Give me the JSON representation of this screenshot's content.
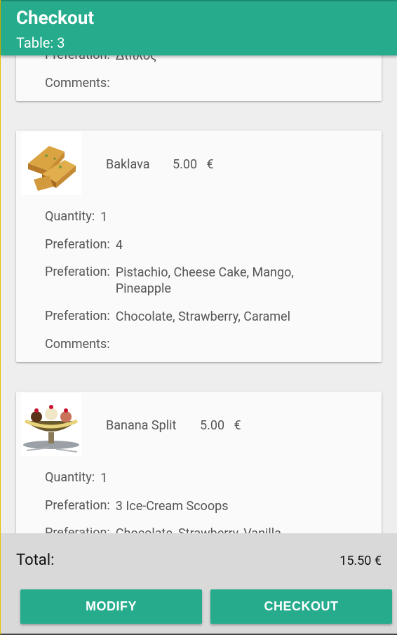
{
  "header": {
    "title": "Checkout",
    "subtitle": "Table: 3"
  },
  "labels": {
    "quantity": "Quantity:",
    "preference": "Preferation:",
    "comments": "Comments:"
  },
  "top_card": {
    "preference_value": "Διπλός"
  },
  "items": [
    {
      "name": "Baklava",
      "price": "5.00",
      "currency": "€",
      "image_icon": "baklava-image",
      "quantity": "1",
      "preferences": [
        "4",
        "Pistachio, Cheese Cake, Mango, Pineapple",
        "Chocolate, Strawberry, Caramel"
      ],
      "comments": ""
    },
    {
      "name": "Banana Split",
      "price": "5.00",
      "currency": "€",
      "image_icon": "banana-split-image",
      "quantity": "1",
      "preferences": [
        "3 Ice-Cream Scoops",
        "Chocolate, Strawberry, Vanilla"
      ]
    }
  ],
  "footer": {
    "total_label": "Total:",
    "total_value": "15.50 €",
    "modify_label": "MODIFY",
    "checkout_label": "CHECKOUT"
  },
  "colors": {
    "primary": "#26ac8c",
    "card_bg": "#fafafa",
    "page_bg": "#eeeeee",
    "footer_bg": "#d9d9d9"
  }
}
